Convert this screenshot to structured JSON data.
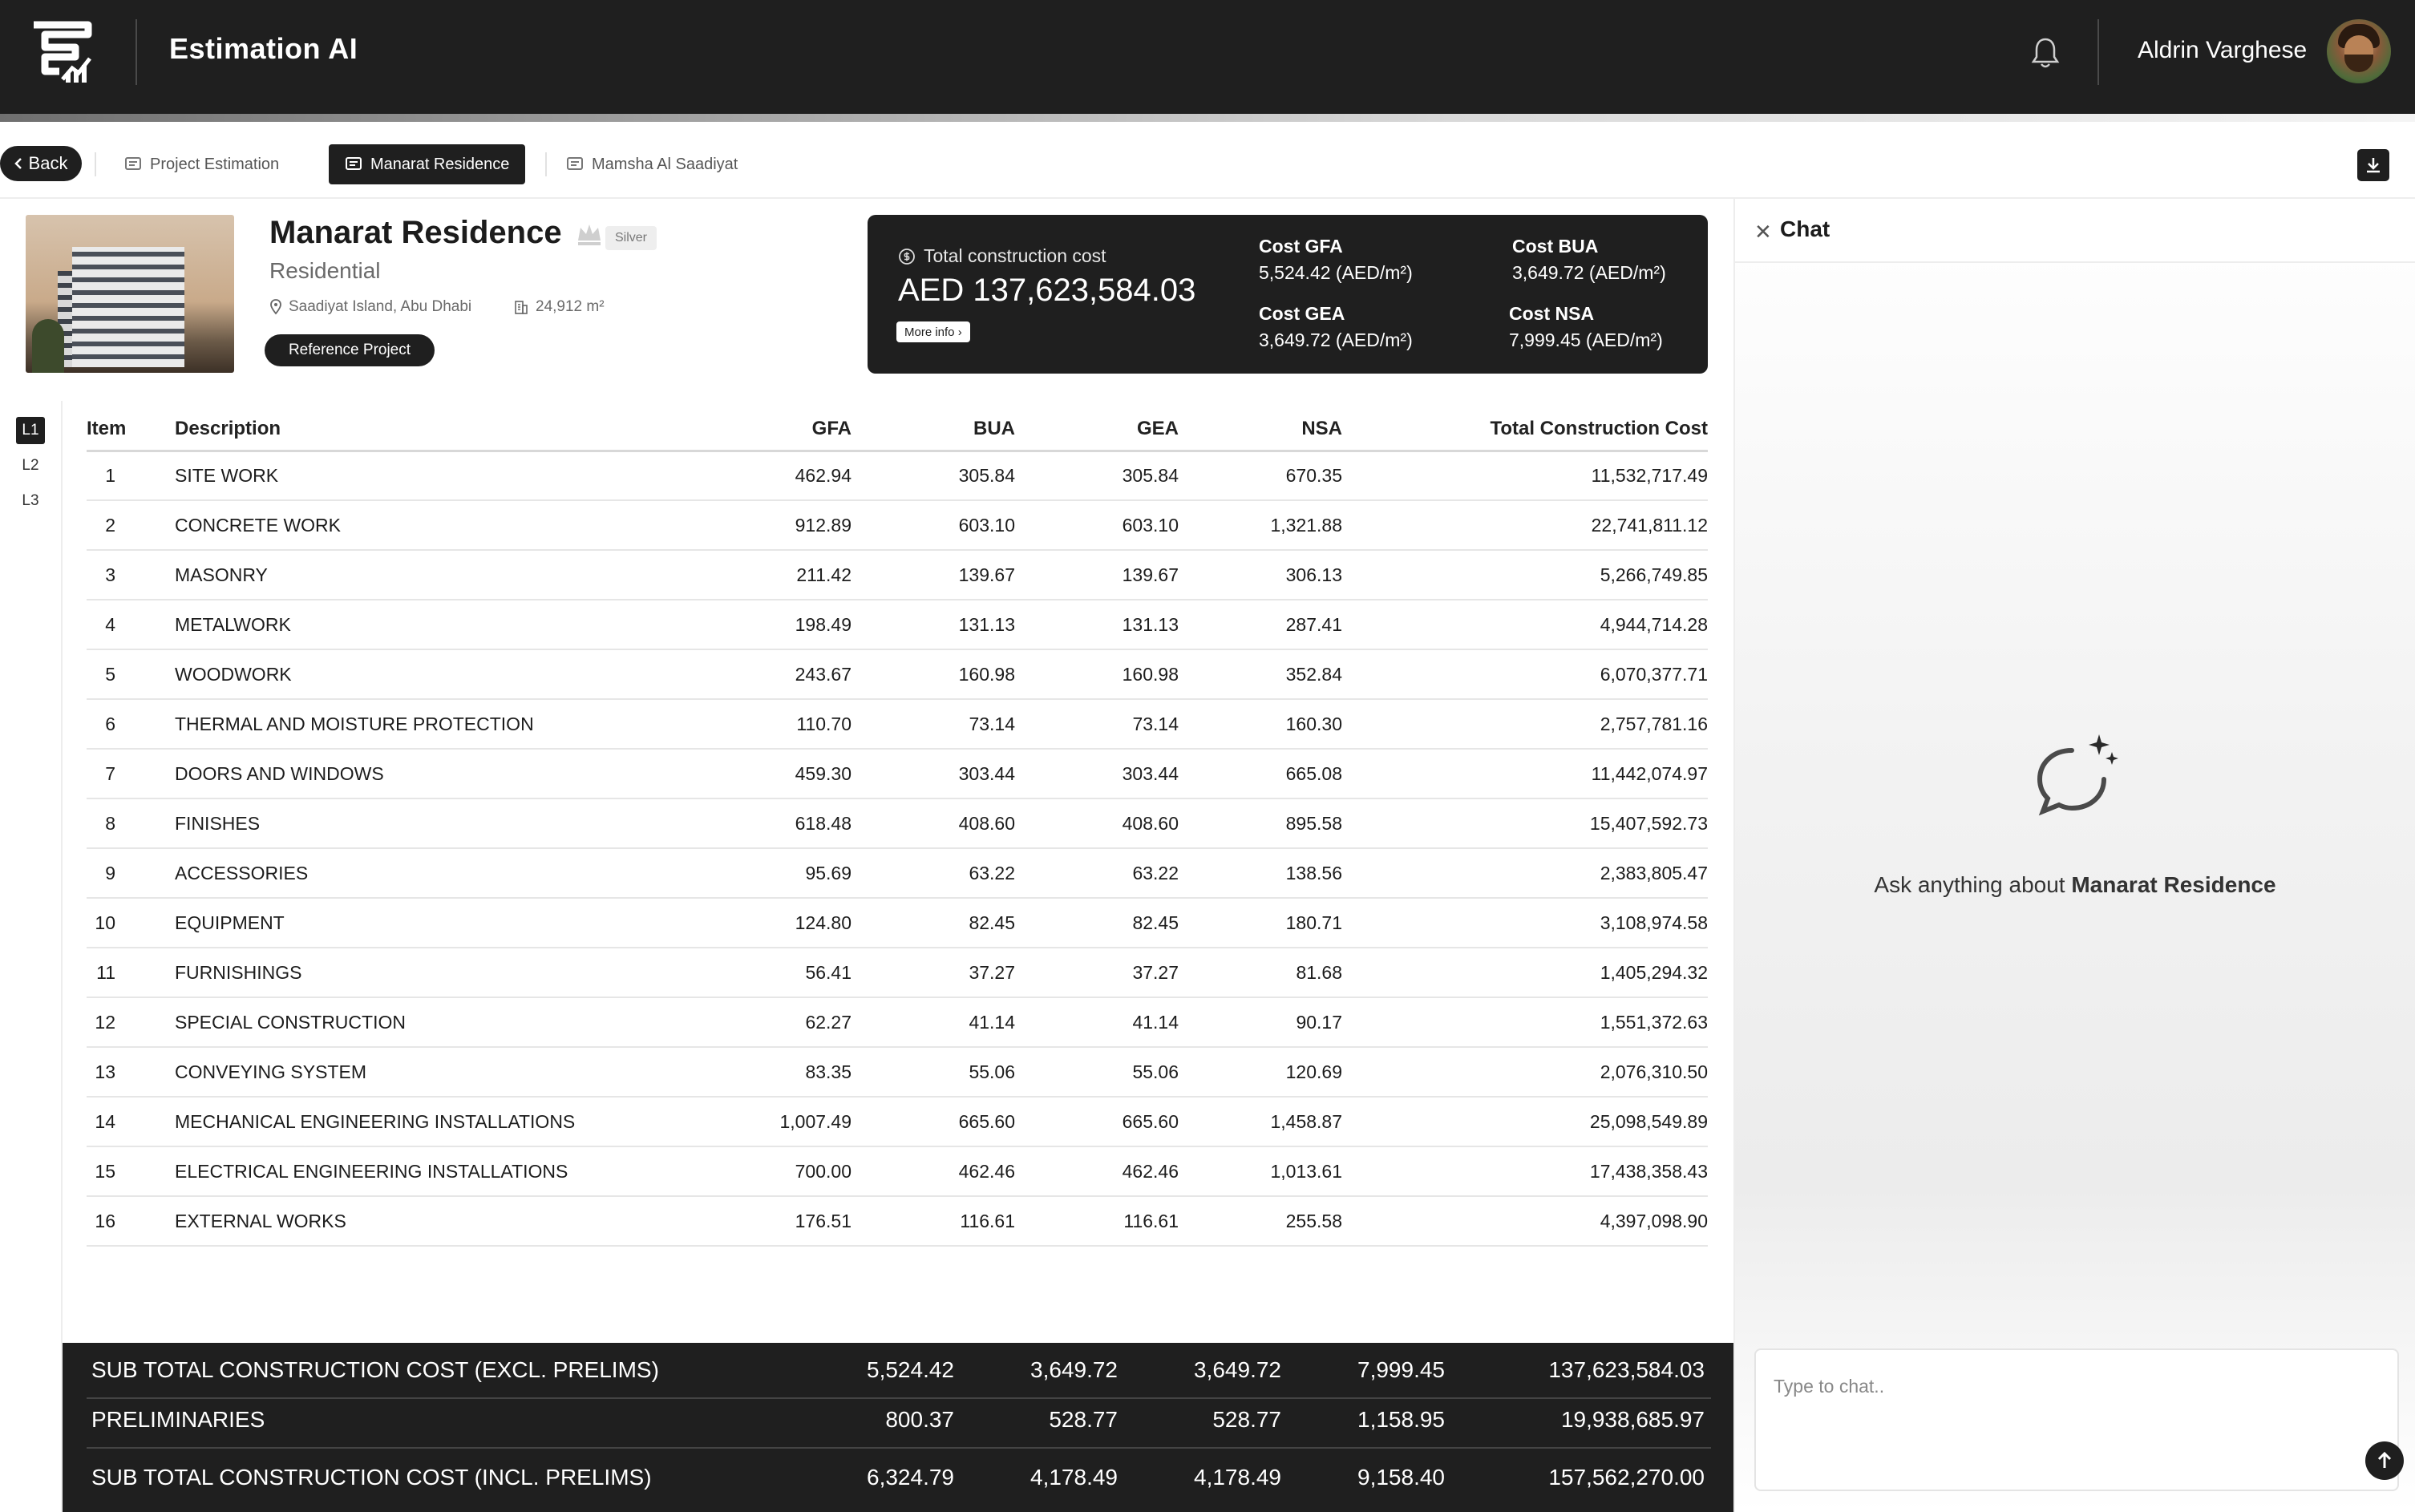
{
  "header": {
    "app_title": "Estimation AI",
    "user_name": "Aldrin Varghese"
  },
  "tabs": {
    "back_label": "Back",
    "items": [
      {
        "label": "Project Estimation"
      },
      {
        "label": "Manarat Residence"
      },
      {
        "label": "Mamsha Al Saadiyat"
      }
    ]
  },
  "project": {
    "title": "Manarat Residence",
    "tier": "Silver",
    "type": "Residential",
    "location": "Saadiyat Island, Abu Dhabi",
    "area": "24,912 m²",
    "reference_button": "Reference Project"
  },
  "cost_card": {
    "total_label": "Total construction cost",
    "total_value": "AED 137,623,584.03",
    "more_info": "More info ›",
    "gfa_label": "Cost GFA",
    "gfa_value": "5,524.42 (AED/m²)",
    "bua_label": "Cost BUA",
    "bua_value": "3,649.72 (AED/m²)",
    "gea_label": "Cost GEA",
    "gea_value": "3,649.72  (AED/m²)",
    "nsa_label": "Cost NSA",
    "nsa_value": "7,999.45 (AED/m²)"
  },
  "levels": [
    "L1",
    "L2",
    "L3"
  ],
  "table": {
    "headers": [
      "Item",
      "Description",
      "GFA",
      "BUA",
      "GEA",
      "NSA",
      "Total Construction Cost"
    ],
    "rows": [
      [
        "1",
        "SITE WORK",
        "462.94",
        "305.84",
        "305.84",
        "670.35",
        "11,532,717.49"
      ],
      [
        "2",
        "CONCRETE WORK",
        "912.89",
        "603.10",
        "603.10",
        "1,321.88",
        "22,741,811.12"
      ],
      [
        "3",
        "MASONRY",
        "211.42",
        "139.67",
        "139.67",
        "306.13",
        "5,266,749.85"
      ],
      [
        "4",
        "METALWORK",
        "198.49",
        "131.13",
        "131.13",
        "287.41",
        "4,944,714.28"
      ],
      [
        "5",
        "WOODWORK",
        "243.67",
        "160.98",
        "160.98",
        "352.84",
        "6,070,377.71"
      ],
      [
        "6",
        "THERMAL AND MOISTURE PROTECTION",
        "110.70",
        "73.14",
        "73.14",
        "160.30",
        "2,757,781.16"
      ],
      [
        "7",
        "DOORS AND WINDOWS",
        "459.30",
        "303.44",
        "303.44",
        "665.08",
        "11,442,074.97"
      ],
      [
        "8",
        "FINISHES",
        "618.48",
        "408.60",
        "408.60",
        "895.58",
        "15,407,592.73"
      ],
      [
        "9",
        "ACCESSORIES",
        "95.69",
        "63.22",
        "63.22",
        "138.56",
        "2,383,805.47"
      ],
      [
        "10",
        "EQUIPMENT",
        "124.80",
        "82.45",
        "82.45",
        "180.71",
        "3,108,974.58"
      ],
      [
        "11",
        "FURNISHINGS",
        "56.41",
        "37.27",
        "37.27",
        "81.68",
        "1,405,294.32"
      ],
      [
        "12",
        "SPECIAL CONSTRUCTION",
        "62.27",
        "41.14",
        "41.14",
        "90.17",
        "1,551,372.63"
      ],
      [
        "13",
        "CONVEYING SYSTEM",
        "83.35",
        "55.06",
        "55.06",
        "120.69",
        "2,076,310.50"
      ],
      [
        "14",
        "MECHANICAL ENGINEERING INSTALLATIONS",
        "1,007.49",
        "665.60",
        "665.60",
        "1,458.87",
        "25,098,549.89"
      ],
      [
        "15",
        "ELECTRICAL ENGINEERING INSTALLATIONS",
        "700.00",
        "462.46",
        "462.46",
        "1,013.61",
        "17,438,358.43"
      ],
      [
        "16",
        "EXTERNAL WORKS",
        "176.51",
        "116.61",
        "116.61",
        "255.58",
        "4,397,098.90"
      ]
    ]
  },
  "totals": [
    [
      "SUB TOTAL CONSTRUCTION COST (EXCL. PRELIMS)",
      "5,524.42",
      "3,649.72",
      "3,649.72",
      "7,999.45",
      "137,623,584.03"
    ],
    [
      "PRELIMINARIES",
      "800.37",
      "528.77",
      "528.77",
      "1,158.95",
      "19,938,685.97"
    ],
    [
      "SUB TOTAL CONSTRUCTION COST (INCL. PRELIMS)",
      "6,324.79",
      "4,178.49",
      "4,178.49",
      "9,158.40",
      "157,562,270.00"
    ]
  ],
  "chat": {
    "title": "Chat",
    "prompt_prefix": "Ask anything about ",
    "prompt_project": "Manarat Residence",
    "input_placeholder": "Type to chat.."
  },
  "colors": {
    "dark": "#1f1f1f",
    "text": "#1c1c1c",
    "muted": "#6a6a6a",
    "divider": "#e6e6e6"
  },
  "icons": [
    "logo-icon",
    "bell-icon",
    "chevron-left-icon",
    "document-icon",
    "download-icon",
    "crown-icon",
    "location-pin-icon",
    "building-icon",
    "dollar-circle-icon",
    "close-icon",
    "chat-sparkle-icon",
    "arrow-up-icon"
  ]
}
